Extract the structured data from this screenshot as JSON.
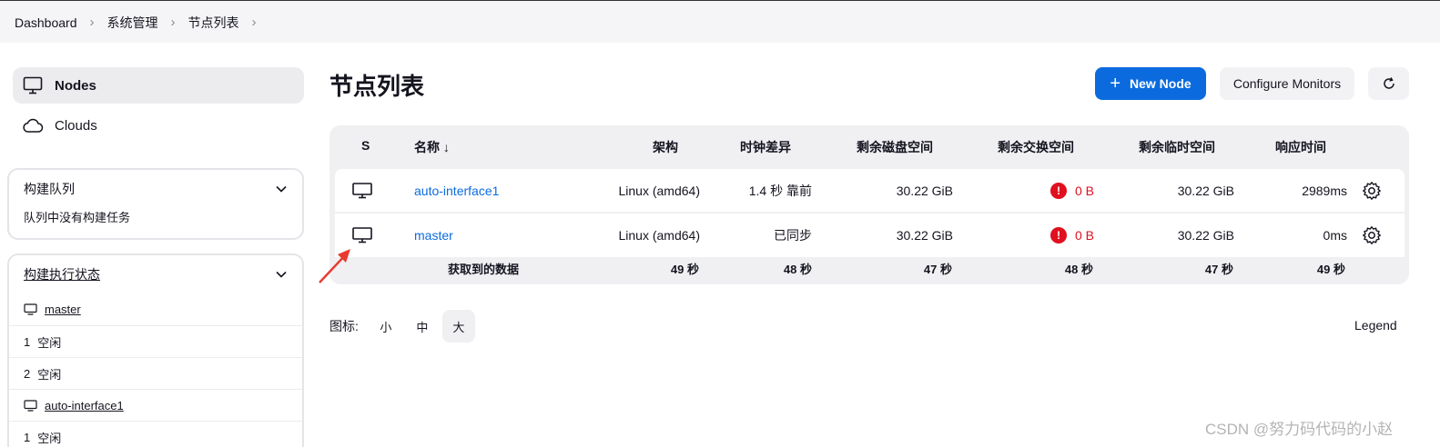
{
  "breadcrumb": [
    "Dashboard",
    "系统管理",
    "节点列表"
  ],
  "sidebar": {
    "items": [
      {
        "label": "Nodes",
        "icon": "computer-icon",
        "active": true
      },
      {
        "label": "Clouds",
        "icon": "cloud-icon",
        "active": false
      }
    ]
  },
  "build_queue": {
    "title": "构建队列",
    "empty_text": "队列中没有构建任务"
  },
  "executor_status": {
    "title": "构建执行状态",
    "master": {
      "name": "master",
      "executors": [
        {
          "num": "1",
          "state": "空闲"
        },
        {
          "num": "2",
          "state": "空闲"
        }
      ]
    },
    "agent": {
      "name": "auto-interface1",
      "executors": [
        {
          "num": "1",
          "state": "空闲"
        }
      ]
    }
  },
  "main": {
    "title": "节点列表",
    "new_node_label": "New Node",
    "configure_monitors_label": "Configure Monitors"
  },
  "table": {
    "headers": {
      "status": "S",
      "name": "名称 ↓",
      "arch": "架构",
      "clock": "时钟差异",
      "disk": "剩余磁盘空间",
      "swap": "剩余交换空间",
      "temp": "剩余临时空间",
      "response": "响应时间"
    },
    "rows": [
      {
        "name": "auto-interface1",
        "arch": "Linux (amd64)",
        "clock": "1.4 秒 靠前",
        "disk": "30.22 GiB",
        "swap": "0 B",
        "temp": "30.22 GiB",
        "response": "2989ms"
      },
      {
        "name": "master",
        "arch": "Linux (amd64)",
        "clock": "已同步",
        "disk": "30.22 GiB",
        "swap": "0 B",
        "temp": "30.22 GiB",
        "response": "0ms"
      }
    ],
    "footer": {
      "label": "获取到的数据",
      "arch": "49 秒",
      "clock": "48 秒",
      "disk": "47 秒",
      "swap": "48 秒",
      "temp": "47 秒",
      "response": "49 秒"
    }
  },
  "icon_size": {
    "label": "图标:",
    "options": [
      "小",
      "中",
      "大"
    ],
    "selected": "大"
  },
  "legend_label": "Legend",
  "watermark": "CSDN @努力码代码的小赵",
  "colors": {
    "accent": "#0b6bde",
    "warning": "#e0101f",
    "annotation_arrow": "#e83a2f"
  }
}
